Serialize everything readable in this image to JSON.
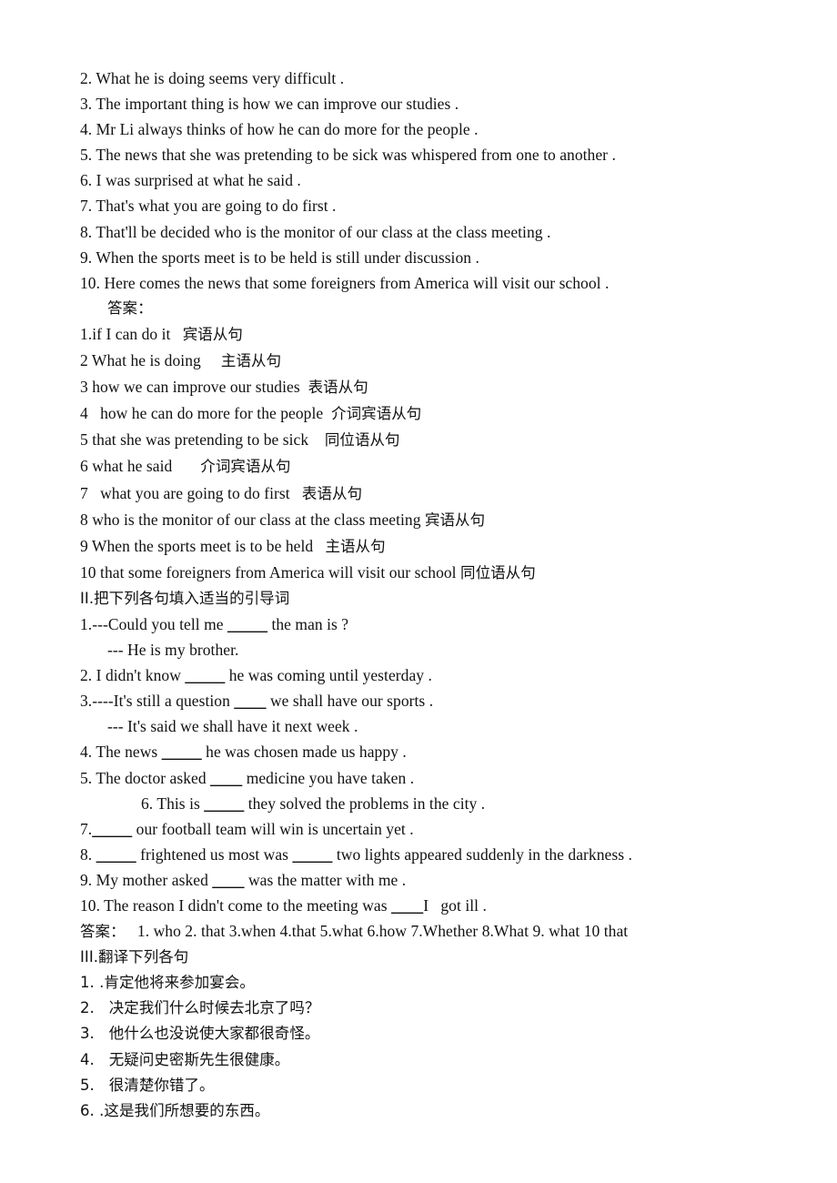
{
  "document": {
    "type": "grammar-worksheet",
    "language_mix": "English and Chinese",
    "text_color": "#111111",
    "background_color": "#ffffff"
  },
  "section_one": {
    "items": [
      "2. What he is doing seems very difficult .",
      "3. The important thing is how we can improve our studies .",
      "4. Mr Li always thinks of how he can do more for the people .",
      "5. The news that she was pretending to be sick was whispered from one to another .",
      "6. I was surprised at what he said .",
      "7. That's what you are going to do first .",
      "8. That'll be decided who is the monitor of our class at the class meeting .",
      "9. When the sports meet is to be held is still under discussion .",
      "10. Here comes the news that some foreigners from America will visit our school ."
    ],
    "answer_label": "答案：",
    "answers": [
      {
        "number": "1.",
        "clause": "if I can do it",
        "gap": "   ",
        "type": "宾语从句"
      },
      {
        "number": "2",
        "clause": " What he is doing",
        "gap": "     ",
        "type": "主语从句"
      },
      {
        "number": "3",
        "clause": " how we can improve our studies",
        "gap": "  ",
        "type": "表语从句"
      },
      {
        "number": "4",
        "clause": "   how he can do more for the people",
        "gap": "  ",
        "type": "介词宾语从句"
      },
      {
        "number": "5",
        "clause": " that she was pretending to be sick",
        "gap": "    ",
        "type": "同位语从句"
      },
      {
        "number": "6",
        "clause": " what he said",
        "gap": "       ",
        "type": "介词宾语从句"
      },
      {
        "number": "7",
        "clause": "   what you are going to do first",
        "gap": "   ",
        "type": "表语从句"
      },
      {
        "number": "8",
        "clause": " who is the monitor of our class at the class meeting",
        "gap": " ",
        "type": "宾语从句"
      },
      {
        "number": "9",
        "clause": " When the sports meet is to be held",
        "gap": "   ",
        "type": "主语从句"
      },
      {
        "number": "10",
        "clause": " that some foreigners from America will visit our school",
        "gap": " ",
        "type": "同位语从句"
      }
    ]
  },
  "section_two": {
    "heading": "II.把下列各句填入适当的引导词",
    "q1_a": "1.---Could you tell me ",
    "q1_blank": "_____",
    "q1_b": " the man is ?",
    "q1_reply": "--- He is my brother.",
    "q2_a": "2. I didn't know ",
    "q2_blank": "_____",
    "q2_b": " he was coming until yesterday .",
    "q3_a": "3.----It's still a question ",
    "q3_blank": "____",
    "q3_b": " we shall have our sports .",
    "q3_reply": "--- It's said we shall have it next week .",
    "q4_a": "4. The news ",
    "q4_blank": "_____",
    "q4_b": " he was chosen made us happy .",
    "q5_a": "5. The doctor asked ",
    "q5_blank": "____",
    "q5_b": " medicine you have taken .",
    "q6_a": "6. This is ",
    "q6_blank": "_____",
    "q6_b": " they solved the problems in the city .",
    "q7_a": "7.",
    "q7_blank": "_____",
    "q7_b": " our football team will win is uncertain yet .",
    "q8_a": "8. ",
    "q8_blank1": "_____",
    "q8_b": " frightened us most was ",
    "q8_blank2": "_____",
    "q8_c": " two lights appeared suddenly in the darkness .",
    "q9_a": "9. My mother asked ",
    "q9_blank": "____",
    "q9_b": " was the matter with me .",
    "q10_a": "10. The reason I didn't come to the meeting was ",
    "q10_blank": "____",
    "q10_b": "I   got ill .",
    "answer_label": "答案：",
    "answer_line": "   1. who 2. that 3.when 4.that 5.what 6.how 7.Whether 8.What 9. what 10 that"
  },
  "section_three": {
    "heading": "III.翻译下列各句",
    "items": [
      "1. .肯定他将来参加宴会。",
      "2.   决定我们什么时候去北京了吗？",
      "3.   他什么也没说使大家都很奇怪。",
      "4.   无疑问史密斯先生很健康。",
      "5.   很清楚你错了。",
      "6. .这是我们所想要的东西。"
    ]
  }
}
